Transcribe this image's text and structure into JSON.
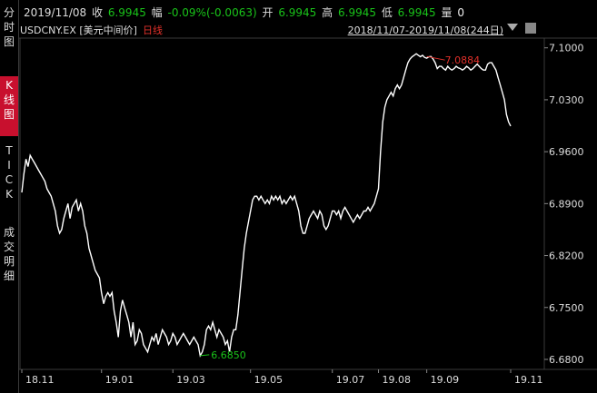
{
  "sidebar": {
    "tabs": [
      {
        "label": "分\n时\n图",
        "active": false
      },
      {
        "label": "K\n线\n图",
        "active": true
      },
      {
        "label": "T\nI\nC\nK",
        "active": false
      },
      {
        "label": "成\n交\n明\n细",
        "active": false
      }
    ]
  },
  "quote": {
    "date": "2019/11/08",
    "close_label": "收",
    "close": "6.9945",
    "change_label": "幅",
    "change": "-0.09%(-0.0063)",
    "open_label": "开",
    "open": "6.9945",
    "high_label": "高",
    "high": "6.9945",
    "low_label": "低",
    "low": "6.9945",
    "volume_label": "量",
    "volume": "0"
  },
  "info": {
    "symbol": "USDCNY.EX [美元中间价]",
    "period": "日线",
    "range": "2018/11/07-2019/11/08(244日)"
  },
  "colors": {
    "line": "#ffffff",
    "up": "#19c319",
    "down": "#e0302a",
    "grid": "#3a3a3a",
    "active_tab": "#c8102e"
  },
  "chart_data": {
    "type": "line",
    "ylim": [
      6.6665,
      7.1131
    ],
    "y_ticks": [
      "7.1000",
      "7.0300",
      "6.9600",
      "6.8900",
      "6.8200",
      "6.7500",
      "6.6800"
    ],
    "x_tick_labels": [
      "18.11",
      "19.01",
      "19.03",
      "19.05",
      "19.07",
      "19.08",
      "19.09",
      "19.11"
    ],
    "x_tick_index": [
      0,
      38,
      72,
      109,
      148,
      170,
      193,
      233
    ],
    "max_annotation": {
      "label": "7.0884",
      "index": 193,
      "value": 7.0884
    },
    "min_annotation": {
      "label": "6.6850",
      "index": 85,
      "value": 6.685
    },
    "series": [
      {
        "values": [
          6.905,
          6.93,
          6.95,
          6.94,
          6.955,
          6.95,
          6.945,
          6.94,
          6.935,
          6.93,
          6.925,
          6.92,
          6.91,
          6.905,
          6.9,
          6.89,
          6.88,
          6.86,
          6.85,
          6.855,
          6.87,
          6.88,
          6.89,
          6.87,
          6.885,
          6.89,
          6.895,
          6.88,
          6.89,
          6.88,
          6.86,
          6.85,
          6.83,
          6.82,
          6.81,
          6.8,
          6.795,
          6.79,
          6.77,
          6.755,
          6.765,
          6.77,
          6.765,
          6.77,
          6.745,
          6.73,
          6.71,
          6.745,
          6.76,
          6.75,
          6.74,
          6.73,
          6.71,
          6.73,
          6.7,
          6.705,
          6.72,
          6.715,
          6.7,
          6.695,
          6.69,
          6.7,
          6.71,
          6.705,
          6.715,
          6.7,
          6.71,
          6.72,
          6.715,
          6.71,
          6.7,
          6.705,
          6.715,
          6.71,
          6.7,
          6.705,
          6.71,
          6.715,
          6.71,
          6.705,
          6.7,
          6.705,
          6.71,
          6.705,
          6.7,
          6.685,
          6.69,
          6.7,
          6.72,
          6.725,
          6.72,
          6.73,
          6.72,
          6.71,
          6.72,
          6.715,
          6.71,
          6.7,
          6.705,
          6.69,
          6.71,
          6.72,
          6.72,
          6.74,
          6.77,
          6.8,
          6.83,
          6.85,
          6.865,
          6.88,
          6.895,
          6.9,
          6.9,
          6.895,
          6.9,
          6.895,
          6.89,
          6.895,
          6.89,
          6.9,
          6.895,
          6.9,
          6.895,
          6.9,
          6.89,
          6.895,
          6.89,
          6.895,
          6.9,
          6.895,
          6.9,
          6.89,
          6.88,
          6.86,
          6.85,
          6.85,
          6.86,
          6.87,
          6.875,
          6.88,
          6.875,
          6.87,
          6.88,
          6.875,
          6.86,
          6.855,
          6.86,
          6.87,
          6.88,
          6.88,
          6.875,
          6.88,
          6.87,
          6.88,
          6.885,
          6.88,
          6.875,
          6.87,
          6.865,
          6.87,
          6.875,
          6.87,
          6.875,
          6.88,
          6.88,
          6.885,
          6.88,
          6.885,
          6.89,
          6.9,
          6.91,
          6.96,
          7.0,
          7.02,
          7.03,
          7.035,
          7.04,
          7.035,
          7.045,
          7.05,
          7.045,
          7.05,
          7.06,
          7.07,
          7.08,
          7.085,
          7.088,
          7.09,
          7.092,
          7.09,
          7.088,
          7.09,
          7.087,
          7.086,
          7.088,
          7.0884,
          7.085,
          7.08,
          7.072,
          7.075,
          7.075,
          7.072,
          7.07,
          7.075,
          7.072,
          7.07,
          7.072,
          7.075,
          7.073,
          7.072,
          7.07,
          7.072,
          7.075,
          7.073,
          7.07,
          7.072,
          7.075,
          7.078,
          7.075,
          7.072,
          7.07,
          7.07,
          7.078,
          7.08,
          7.08,
          7.075,
          7.07,
          7.06,
          7.05,
          7.04,
          7.03,
          7.01,
          7.0,
          6.9945
        ]
      }
    ]
  }
}
